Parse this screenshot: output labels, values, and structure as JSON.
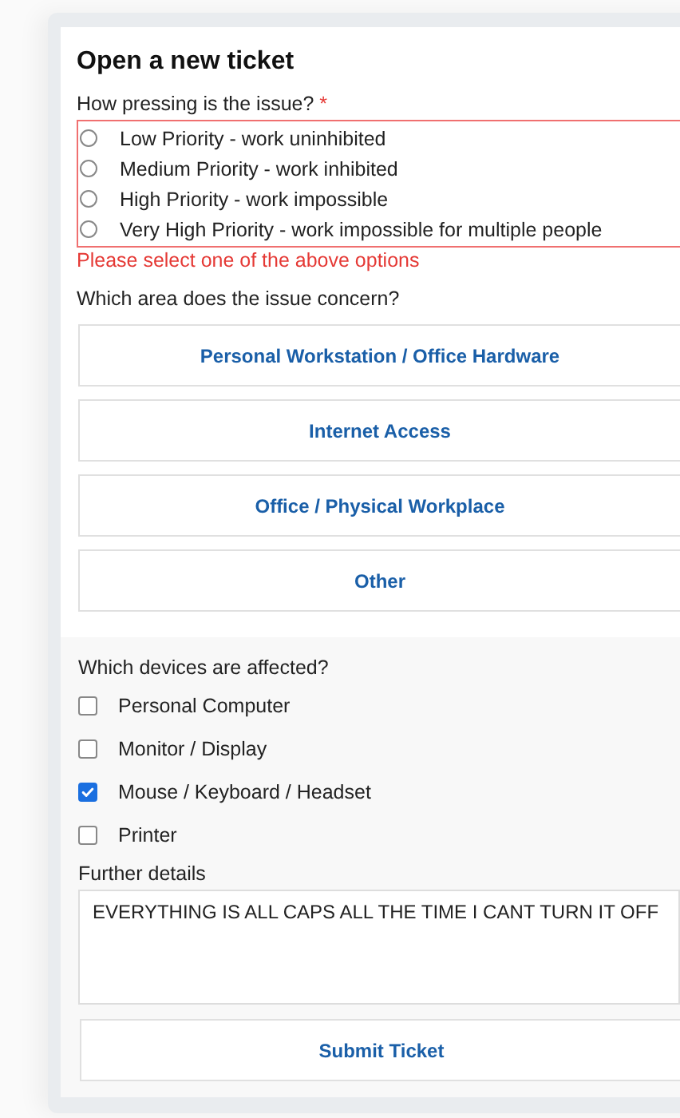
{
  "title": "Open a new ticket",
  "priority": {
    "label": "How pressing is the issue?",
    "required_mark": "*",
    "invalid": true,
    "error": "Please select one of the above options",
    "options": [
      {
        "label": "Low Priority - work uninhibited",
        "selected": false
      },
      {
        "label": "Medium Priority - work inhibited",
        "selected": false
      },
      {
        "label": "High Priority - work impossible",
        "selected": false
      },
      {
        "label": "Very High Priority - work impossible for multiple people",
        "selected": false
      }
    ]
  },
  "area": {
    "label": "Which area does the issue concern?",
    "options": [
      {
        "label": "Personal Workstation / Office Hardware",
        "selected": false
      },
      {
        "label": "Internet Access",
        "selected": false
      },
      {
        "label": "Office / Physical Workplace",
        "selected": false
      },
      {
        "label": "Other",
        "selected": false
      }
    ]
  },
  "devices": {
    "label": "Which devices are affected?",
    "items": [
      {
        "label": "Personal Computer",
        "checked": false
      },
      {
        "label": "Monitor / Display",
        "checked": false
      },
      {
        "label": "Mouse / Keyboard / Headset",
        "checked": true
      },
      {
        "label": "Printer",
        "checked": false
      }
    ]
  },
  "details": {
    "label": "Further details",
    "value": "EVERYTHING IS ALL CAPS ALL THE TIME I CANT TURN IT OFF"
  },
  "submit": "Submit Ticket"
}
